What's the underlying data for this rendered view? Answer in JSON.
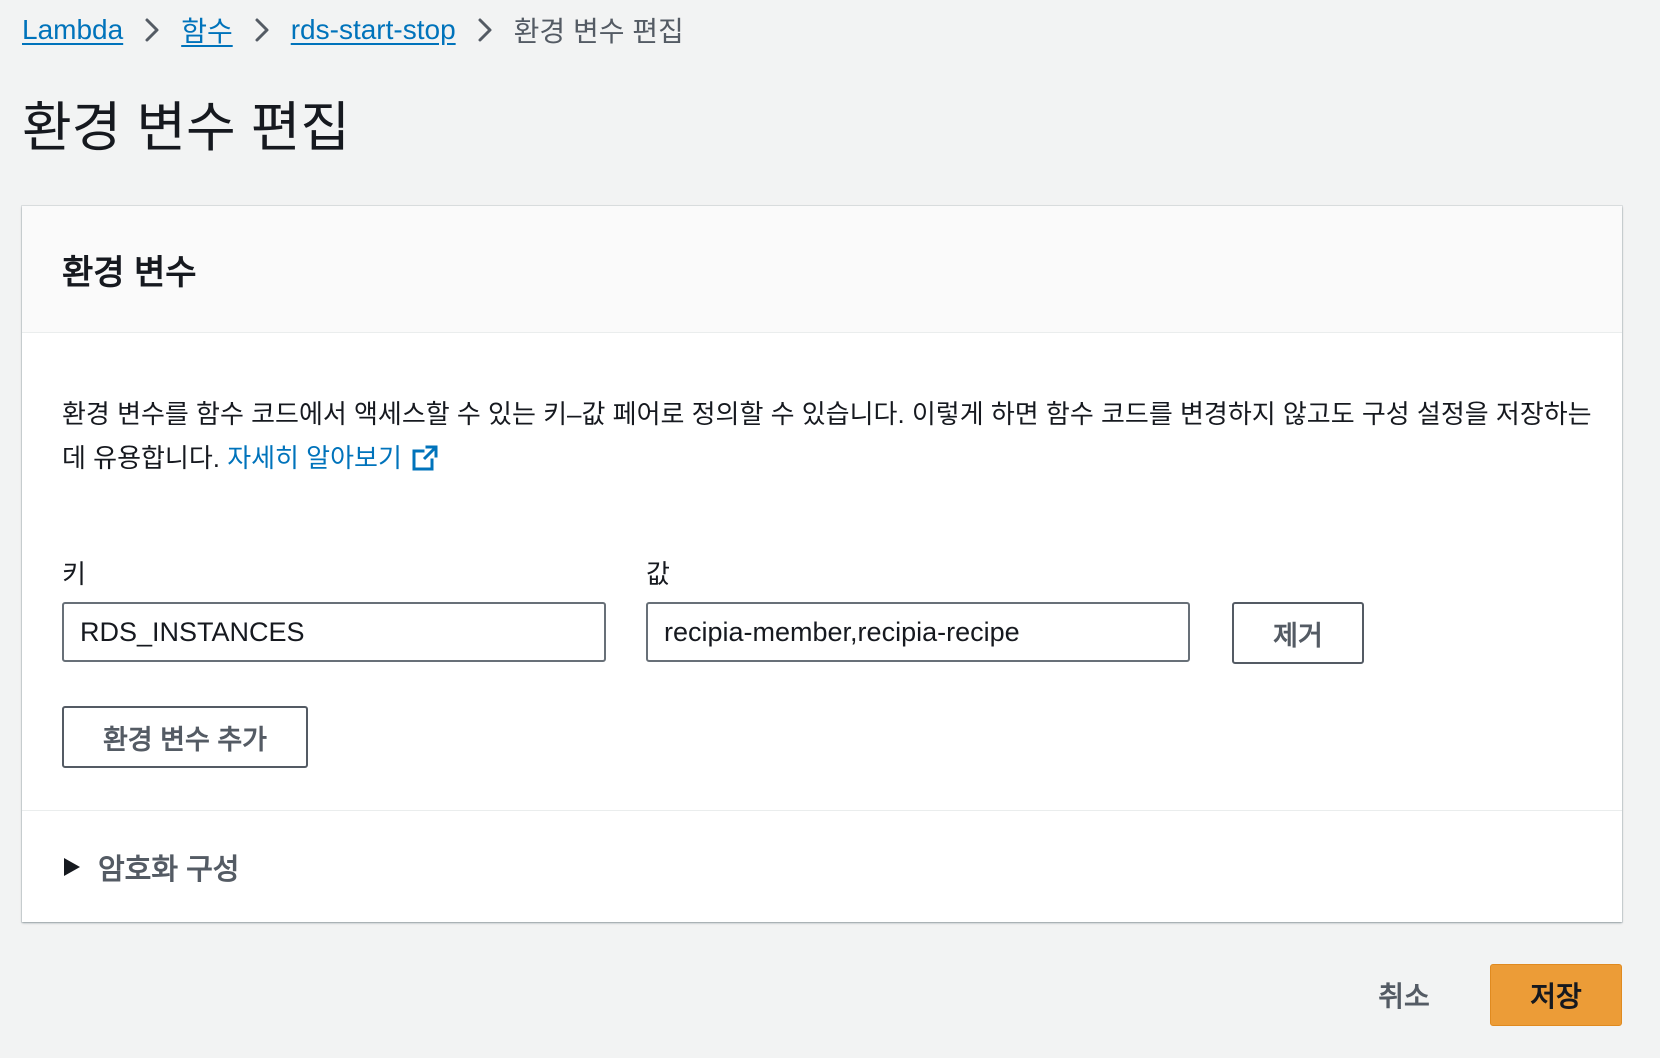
{
  "breadcrumb": {
    "items": [
      {
        "label": "Lambda"
      },
      {
        "label": "함수"
      },
      {
        "label": "rds-start-stop"
      },
      {
        "label": "환경 변수 편집"
      }
    ],
    "separator_icon": "chevron-right-icon"
  },
  "page": {
    "title": "환경 변수 편집"
  },
  "panel": {
    "title": "환경 변수",
    "description": "환경 변수를 함수 코드에서 액세스할 수 있는 키–값 페어로 정의할 수 있습니다. 이렇게 하면 함수 코드를 변경하지 않고도 구성 설정을 저장하는 데 유용합니다. ",
    "learn_more_label": "자세히 알아보기",
    "learn_more_icon": "external-link-icon",
    "key_label": "키",
    "value_label": "값",
    "variables": [
      {
        "key": "RDS_INSTANCES",
        "value": "recipia-member,recipia-recipe",
        "remove_label": "제거"
      }
    ],
    "add_button_label": "환경 변수 추가",
    "encryption": {
      "label": "암호화 구성",
      "expanded": false,
      "icon": "caret-right-icon"
    }
  },
  "footer": {
    "cancel_label": "취소",
    "save_label": "저장"
  },
  "colors": {
    "background": "#f2f3f3",
    "link": "#0073bb",
    "primary_button": "#ec9c37",
    "text": "#16191f",
    "secondary_text": "#545b64"
  }
}
